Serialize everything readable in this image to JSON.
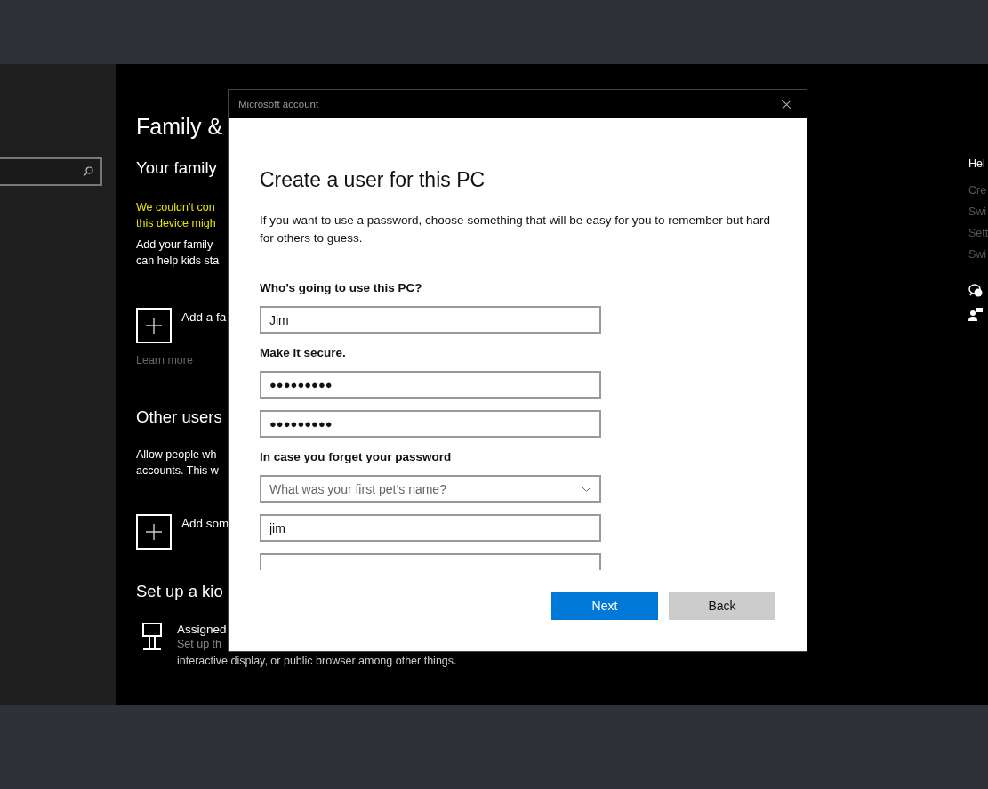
{
  "settings": {
    "title": "Family &",
    "sections": [
      {
        "kind": "family",
        "heading": "Your family",
        "warning": [
          "We couldn’t con",
          "this device migh"
        ],
        "text": [
          "Add your family",
          "can help kids sta"
        ],
        "add_label": "Add a fa",
        "link": "Learn more"
      },
      {
        "kind": "others",
        "heading": "Other users",
        "text": [
          "Allow people wh",
          "accounts. This w"
        ],
        "add_label": "Add som"
      },
      {
        "kind": "kiosk",
        "heading": "Set up a kio",
        "item_title": "Assigned",
        "item_text": [
          "Set up th",
          "interactive display, or public browser among other things."
        ]
      }
    ]
  },
  "help": {
    "heading": "Hel",
    "links": [
      "Cre",
      "Swi",
      "Sett",
      "Swi"
    ]
  },
  "dialog": {
    "title": "Microsoft account",
    "heading": "Create a user for this PC",
    "intro": "If you want to use a password, choose something that will be easy for you to remember but hard for others to guess.",
    "groups": [
      {
        "label": "Who’s going to use this PC?",
        "fields": [
          {
            "kind": "text",
            "value": "Jim"
          }
        ]
      },
      {
        "label": "Make it secure.",
        "fields": [
          {
            "kind": "password",
            "value": "●●●●●●●●●"
          },
          {
            "kind": "password",
            "value": "●●●●●●●●●"
          }
        ]
      },
      {
        "label": "In case you forget your password",
        "fields": [
          {
            "kind": "select",
            "value": "What was your first pet’s name?"
          },
          {
            "kind": "text",
            "value": "jim"
          },
          {
            "kind": "text"
          }
        ]
      }
    ],
    "buttons": [
      {
        "label": "Next",
        "primary": true
      },
      {
        "label": "Back",
        "primary": false
      }
    ]
  }
}
